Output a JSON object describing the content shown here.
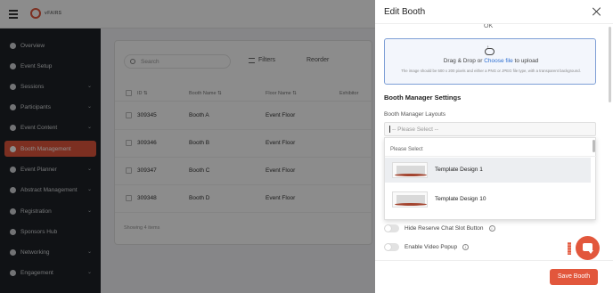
{
  "app": {
    "logo_text": "vFAIRS"
  },
  "sidebar": {
    "items": [
      {
        "label": "Overview",
        "icon": "dashboard-icon",
        "chevron": ""
      },
      {
        "label": "Event Setup",
        "icon": "settings-icon",
        "chevron": ""
      },
      {
        "label": "Sessions",
        "icon": "sessions-icon",
        "chevron": "⌄"
      },
      {
        "label": "Participants",
        "icon": "users-icon",
        "chevron": "⌄"
      },
      {
        "label": "Event Content",
        "icon": "content-icon",
        "chevron": "⌄"
      },
      {
        "label": "Booth Management",
        "icon": "booth-icon",
        "chevron": "",
        "active": true
      },
      {
        "label": "Event Planner",
        "icon": "planner-icon",
        "chevron": "⌄"
      },
      {
        "label": "Abstract Management",
        "icon": "abstract-icon",
        "chevron": "⌄"
      },
      {
        "label": "Registration",
        "icon": "registration-icon",
        "chevron": "⌄"
      },
      {
        "label": "Sponsors Hub",
        "icon": "sponsors-icon",
        "chevron": ""
      },
      {
        "label": "Networking",
        "icon": "networking-icon",
        "chevron": "⌄"
      },
      {
        "label": "Engagement",
        "icon": "engagement-icon",
        "chevron": "⌄"
      }
    ]
  },
  "main": {
    "search_placeholder": "Search",
    "filters_label": "Filters",
    "reorder_label": "Reorder",
    "columns": [
      "ID ⇅",
      "Booth Name ⇅",
      "Floor Name ⇅",
      "Exhibitor"
    ],
    "rows": [
      {
        "id": "309345",
        "name": "Booth A",
        "floor": "Event Floor"
      },
      {
        "id": "309346",
        "name": "Booth B",
        "floor": "Event Floor"
      },
      {
        "id": "309347",
        "name": "Booth C",
        "floor": "Event Floor"
      },
      {
        "id": "309348",
        "name": "Booth D",
        "floor": "Event Floor"
      }
    ],
    "showing_text": "Showing 4 items"
  },
  "drawer": {
    "title": "Edit Booth",
    "ok_text": "OK",
    "dropzone": {
      "text_before": "Drag & Drop or ",
      "link": "Choose file",
      "text_after": " to upload",
      "hint": "The image should be 500 x 200 pixels and either a PNG or JPEG file type, with a transparent background."
    },
    "section_title": "Booth Manager Settings",
    "layouts_label": "Booth Manager Layouts",
    "select_placeholder": "-- Please Select --",
    "dropdown": {
      "placeholder": "Please Select",
      "options": [
        "Template Design 1",
        "Template Design 10"
      ]
    },
    "toggles": [
      {
        "label": "Hide Reserve Chat Slot Button"
      },
      {
        "label": "Enable Video Popup"
      }
    ],
    "save_label": "Save Booth"
  },
  "colors": {
    "accent": "#e2573c",
    "sidebar_bg": "#1e2227",
    "link": "#2e6fd1",
    "dropzone_border": "#7e9fd6"
  }
}
